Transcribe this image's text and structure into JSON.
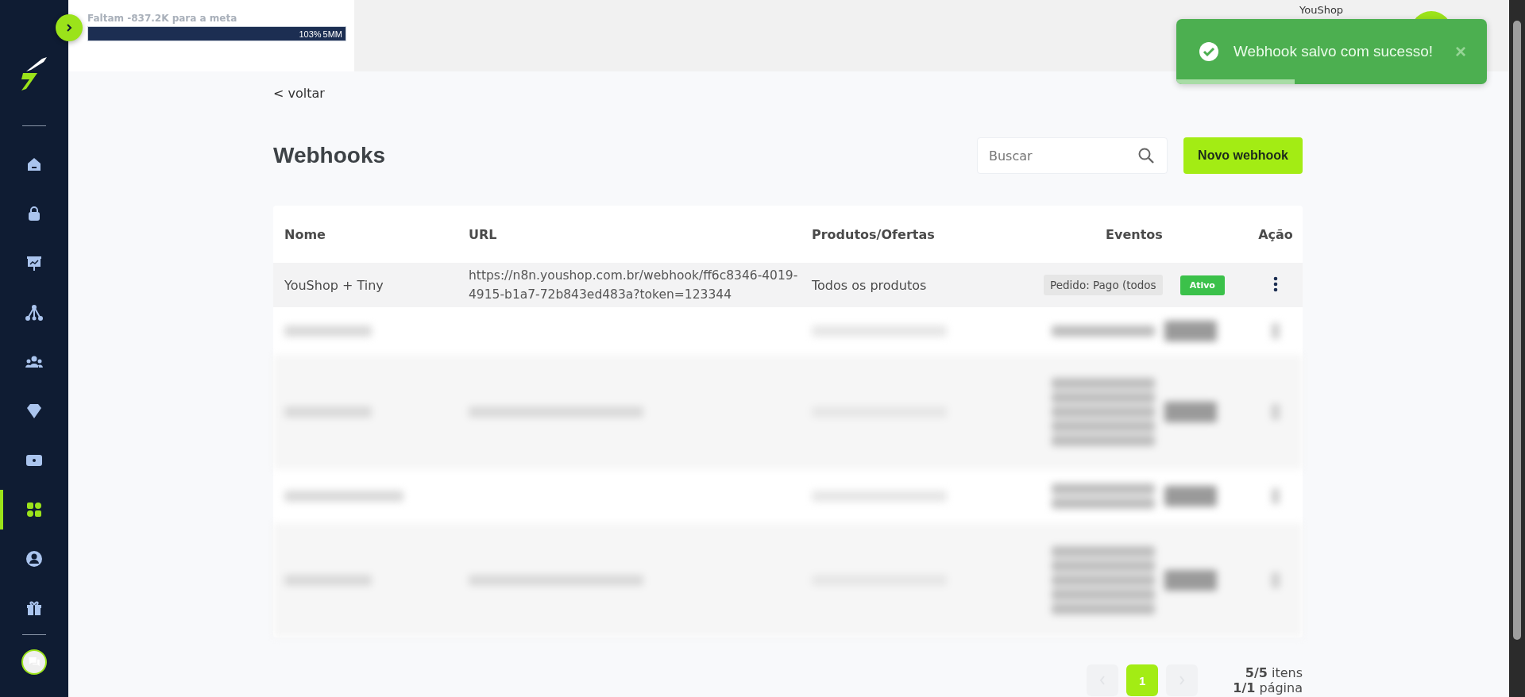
{
  "sidebar": {
    "items": [
      {
        "selected": false
      },
      {
        "selected": false
      },
      {
        "selected": false
      },
      {
        "selected": false
      },
      {
        "selected": false
      },
      {
        "selected": false
      },
      {
        "selected": false
      },
      {
        "selected": true
      },
      {
        "selected": false
      },
      {
        "selected": false
      }
    ]
  },
  "goal": {
    "text": "Faltam -837.2K para a meta",
    "level": 1,
    "percent": "103%",
    "target": "5MM"
  },
  "user": {
    "name": "YouShop"
  },
  "toast": {
    "message": "Webhook salvo com sucesso!",
    "close": "×",
    "level": 0.38
  },
  "back_link": "< voltar",
  "title": "Webhooks",
  "search": {
    "placeholder": "Buscar"
  },
  "new_button": "Novo webhook",
  "table": {
    "columns": [
      "Nome",
      "URL",
      "Produtos/Ofertas",
      "Eventos",
      "Ação"
    ],
    "rows": [
      {
        "name": "YouShop + Tiny",
        "url": "https://n8n.youshop.com.br/webhook/ff6c8346-4019-4915-b1a7-72b843ed483a?token=123344",
        "products": "Todos os produtos",
        "event": "Pedido: Pago (todos",
        "status": "Ativo",
        "active": true
      }
    ],
    "blurred_rows": [
      {
        "kind": "single"
      },
      {
        "kind": "tall"
      },
      {
        "kind": "double"
      },
      {
        "kind": "tall"
      }
    ]
  },
  "pagination": {
    "pages": [
      {
        "label": "1",
        "selected": true
      }
    ],
    "items_count": "5/5",
    "items_label": "itens",
    "pages_count": "1/1",
    "pages_label": "página"
  }
}
